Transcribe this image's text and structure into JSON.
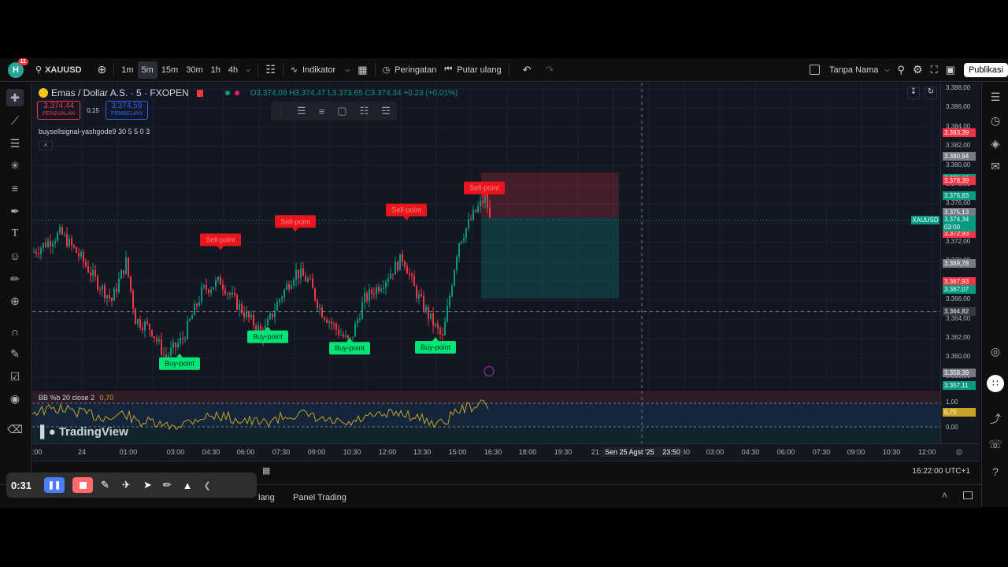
{
  "topbar": {
    "avatar_letter": "H",
    "notif_count": "11",
    "symbol": "XAUUSD",
    "timeframes": [
      "1m",
      "5m",
      "15m",
      "30m",
      "1h",
      "4h"
    ],
    "indicators_label": "Indikator",
    "alerts_label": "Peringatan",
    "replay_label": "Putar ulang",
    "layout_name": "Tanpa Nama",
    "publish_label": "Publikasi"
  },
  "legend": {
    "title": "Emas / Dollar A.S. · 5 · FXOPEN",
    "ohlc": "O3.374,09 H3.374,47 L3.373,65 C3.374,34 +0,23 (+0,01%)",
    "sell_price": "3.374,44",
    "sell_label": "PENJUALAN",
    "spread": "0,15",
    "buy_price": "3.374,59",
    "buy_label": "PEMBELIAN",
    "indicator_name": "buysellsignal-yashgode9 30 5 5 0 3"
  },
  "signals": {
    "sell": [
      "Sell-point",
      "Sell-point",
      "Sell-point",
      "Sell-point"
    ],
    "buy": [
      "Buy-point",
      "Buy-point",
      "Buy-point",
      "Buy-point"
    ]
  },
  "bb": {
    "label": "BB %b 20 close 2",
    "value": "0,70"
  },
  "watermark": "TradingView",
  "price_axis": {
    "ticks": [
      "3.388,00",
      "3.386,00",
      "3.384,00",
      "3.382,00",
      "3.380,00",
      "3.378,00",
      "3.376,00",
      "3.374,00",
      "3.372,00",
      "3.370,00",
      "3.368,00",
      "3.366,00",
      "3.364,00",
      "3.362,00",
      "3.360,00",
      "3.358,00"
    ],
    "labels": [
      {
        "text": "3.383,39",
        "color": "#f23645"
      },
      {
        "text": "3.380,94",
        "color": "#787b86"
      },
      {
        "text": "3.378,62",
        "color": "#089981"
      },
      {
        "text": "3.378,39",
        "color": "#f23645"
      },
      {
        "text": "3.376,83",
        "color": "#089981"
      },
      {
        "text": "3.375,13",
        "color": "#787b86"
      },
      {
        "text": "3.372,93",
        "color": "#f23645"
      },
      {
        "text": "3.369,78",
        "color": "#787b86"
      },
      {
        "text": "3.367,93",
        "color": "#f23645"
      },
      {
        "text": "3.367,07",
        "color": "#089981"
      },
      {
        "text": "3.364,82",
        "color": "#5d606b"
      },
      {
        "text": "3.358,39",
        "color": "#787b86"
      },
      {
        "text": "3.357,11",
        "color": "#089981"
      }
    ],
    "current_price": "3.374,34",
    "countdown": "03:00",
    "symbol_tag": "XAUUSD",
    "ind_ticks": [
      "1,00",
      "0,00"
    ],
    "ind_value": "0,70"
  },
  "time_axis": {
    "ticks": [
      ":00",
      "24",
      "01:00",
      "03:00",
      "04:30",
      "06:00",
      "07:30",
      "09:00",
      "10:30",
      "12:00",
      "13:30",
      "15:00",
      "16:30",
      "18:00",
      "19:30",
      "21:",
      "30",
      "03:00",
      "04:30",
      "06:00",
      "07:30",
      "09:00",
      "10:30",
      "12:00"
    ],
    "crosshair_label": "Sen 25 Agst '25",
    "crosshair_time": "23:50"
  },
  "clock": "16:22:00 UTC+1",
  "footer": {
    "tab_partial": "lang",
    "tab_trading": "Panel Trading"
  },
  "recorder": {
    "time": "0:31"
  },
  "colors": {
    "up": "#089981",
    "down": "#f23645",
    "bg": "#131722",
    "signal_sell": "#e8151f",
    "signal_buy": "#00e676",
    "bb_line": "#c9a227"
  }
}
